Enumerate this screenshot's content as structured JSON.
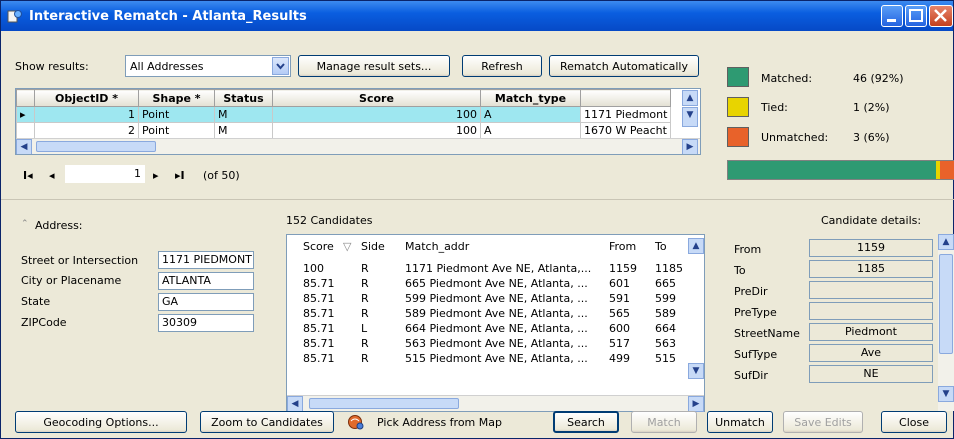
{
  "window": {
    "title": "Interactive Rematch - Atlanta_Results"
  },
  "toolbar": {
    "show_results_label": "Show results:",
    "show_results_value": "All Addresses",
    "manage_label": "Manage result sets...",
    "refresh_label": "Refresh",
    "rematch_label": "Rematch Automatically"
  },
  "results_table": {
    "columns": [
      "ObjectID *",
      "Shape *",
      "Status",
      "Score",
      "Match_type",
      ""
    ],
    "rows": [
      [
        "1",
        "Point",
        "M",
        "100",
        "A",
        "1171 Piedmont"
      ],
      [
        "2",
        "Point",
        "M",
        "100",
        "A",
        "1670 W Peacht"
      ]
    ]
  },
  "nav": {
    "current": "1",
    "of_text": "(of 50)"
  },
  "summary": {
    "matched_label": "Matched:",
    "matched_value": "46 (92%)",
    "matched_color": "#2e9a72",
    "tied_label": "Tied:",
    "tied_value": "1 (2%)",
    "tied_color": "#e8d400",
    "unmatched_label": "Unmatched:",
    "unmatched_value": "3 (6%)",
    "unmatched_color": "#e8622a",
    "bar": {
      "matched_fraction": 0.92,
      "tied_fraction": 0.02,
      "unmatched_fraction": 0.06
    }
  },
  "address": {
    "header": "Address:",
    "fields": [
      {
        "label": "Street or Intersection",
        "value": "1171 PIEDMONT"
      },
      {
        "label": "City or Placename",
        "value": "ATLANTA"
      },
      {
        "label": "State",
        "value": "GA"
      },
      {
        "label": "ZIPCode",
        "value": "30309"
      }
    ]
  },
  "candidates": {
    "count_label": "152 Candidates",
    "columns": [
      "Score",
      "Side",
      "Match_addr",
      "From",
      "To"
    ],
    "rows": [
      [
        "100",
        "R",
        "1171 Piedmont Ave NE, Atlanta,...",
        "1159",
        "1185"
      ],
      [
        "85.71",
        "R",
        "665 Piedmont Ave NE, Atlanta, ...",
        "601",
        "665"
      ],
      [
        "85.71",
        "R",
        "599 Piedmont Ave NE, Atlanta, ...",
        "591",
        "599"
      ],
      [
        "85.71",
        "R",
        "589 Piedmont Ave NE, Atlanta, ...",
        "565",
        "589"
      ],
      [
        "85.71",
        "L",
        "664 Piedmont Ave NE, Atlanta, ...",
        "600",
        "664"
      ],
      [
        "85.71",
        "R",
        "563 Piedmont Ave NE, Atlanta, ...",
        "517",
        "563"
      ],
      [
        "85.71",
        "R",
        "515 Piedmont Ave NE, Atlanta, ...",
        "499",
        "515"
      ]
    ]
  },
  "details": {
    "header": "Candidate details:",
    "rows": [
      {
        "label": "From",
        "value": "1159"
      },
      {
        "label": "To",
        "value": "1185"
      },
      {
        "label": "PreDir",
        "value": ""
      },
      {
        "label": "PreType",
        "value": ""
      },
      {
        "label": "StreetName",
        "value": "Piedmont"
      },
      {
        "label": "SufType",
        "value": "Ave"
      },
      {
        "label": "SufDir",
        "value": "NE"
      }
    ]
  },
  "bottom": {
    "geocoding_label": "Geocoding Options...",
    "zoom_label": "Zoom to Candidates",
    "pick_label": "Pick Address from Map",
    "search_label": "Search",
    "match_label": "Match",
    "unmatch_label": "Unmatch",
    "save_label": "Save Edits",
    "close_label": "Close"
  }
}
